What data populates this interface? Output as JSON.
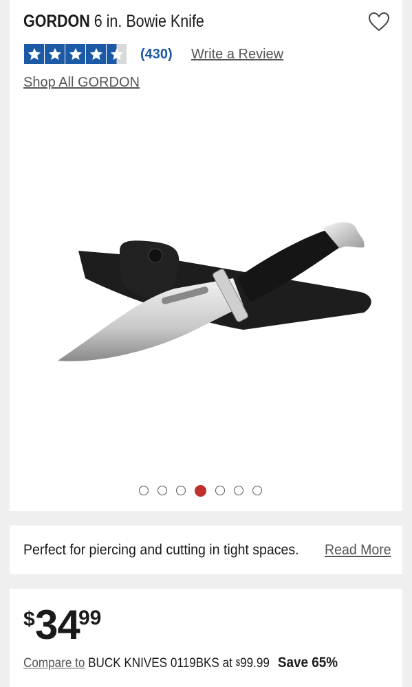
{
  "product": {
    "brand": "GORDON",
    "name": "6 in. Bowie Knife",
    "rating": 4.5,
    "review_count": "(430)",
    "write_review": "Write a Review",
    "shop_all": "Shop All GORDON",
    "carousel": {
      "total": 7,
      "active_index": 3
    }
  },
  "description": {
    "text": "Perfect for piercing and cutting in tight spaces.",
    "read_more": "Read More"
  },
  "pricing": {
    "currency": "$",
    "dollars": "34",
    "cents": "99",
    "compare_label": "Compare to",
    "compare_product": "BUCK KNIVES 0119BKS at",
    "compare_currency": "$",
    "compare_price": "99.99",
    "save": "Save 65%"
  },
  "colors": {
    "star_blue": "#1c5aa5",
    "carousel_active": "#c0302a"
  },
  "icons": [
    "heart-icon",
    "star-icon"
  ]
}
